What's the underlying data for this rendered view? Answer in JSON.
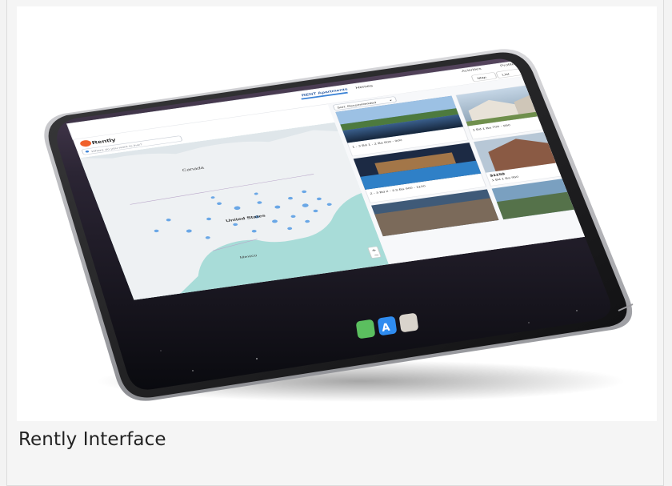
{
  "caption": "Rently Interface",
  "app": {
    "logo_text": "Rently",
    "search_placeholder": "Where do you want to live?",
    "tabs": [
      "RENT Apartments",
      "Homes"
    ],
    "header_links": [
      "Activities",
      "Profile"
    ],
    "view_toggle": [
      "Map",
      "List"
    ],
    "sort_label": "Sort: Recommended"
  },
  "map": {
    "labels": [
      "Canada",
      "United States",
      "Mexico"
    ]
  },
  "listings": [
    {
      "price": "",
      "details": "1 - 3 Bd  1 - 2 Ba  600 - 900"
    },
    {
      "price": "",
      "details": "1 Bd  1 Ba  700 - 950"
    },
    {
      "price": "",
      "details": "2 - 3 Bd  2 - 2.5 Ba  900 - 1100"
    },
    {
      "price": "$1159",
      "details": "1 Bd  1 Ba  950"
    }
  ],
  "dock_apps": [
    "maps-app-icon",
    "app-store-icon",
    "photos-app-icon"
  ],
  "colors": {
    "brand": "#f0612b",
    "map_water": "#a8dcd8",
    "map_land": "#eef1f3",
    "marker": "#6aa7e6",
    "wallpaper_top": "#4a3a52"
  }
}
